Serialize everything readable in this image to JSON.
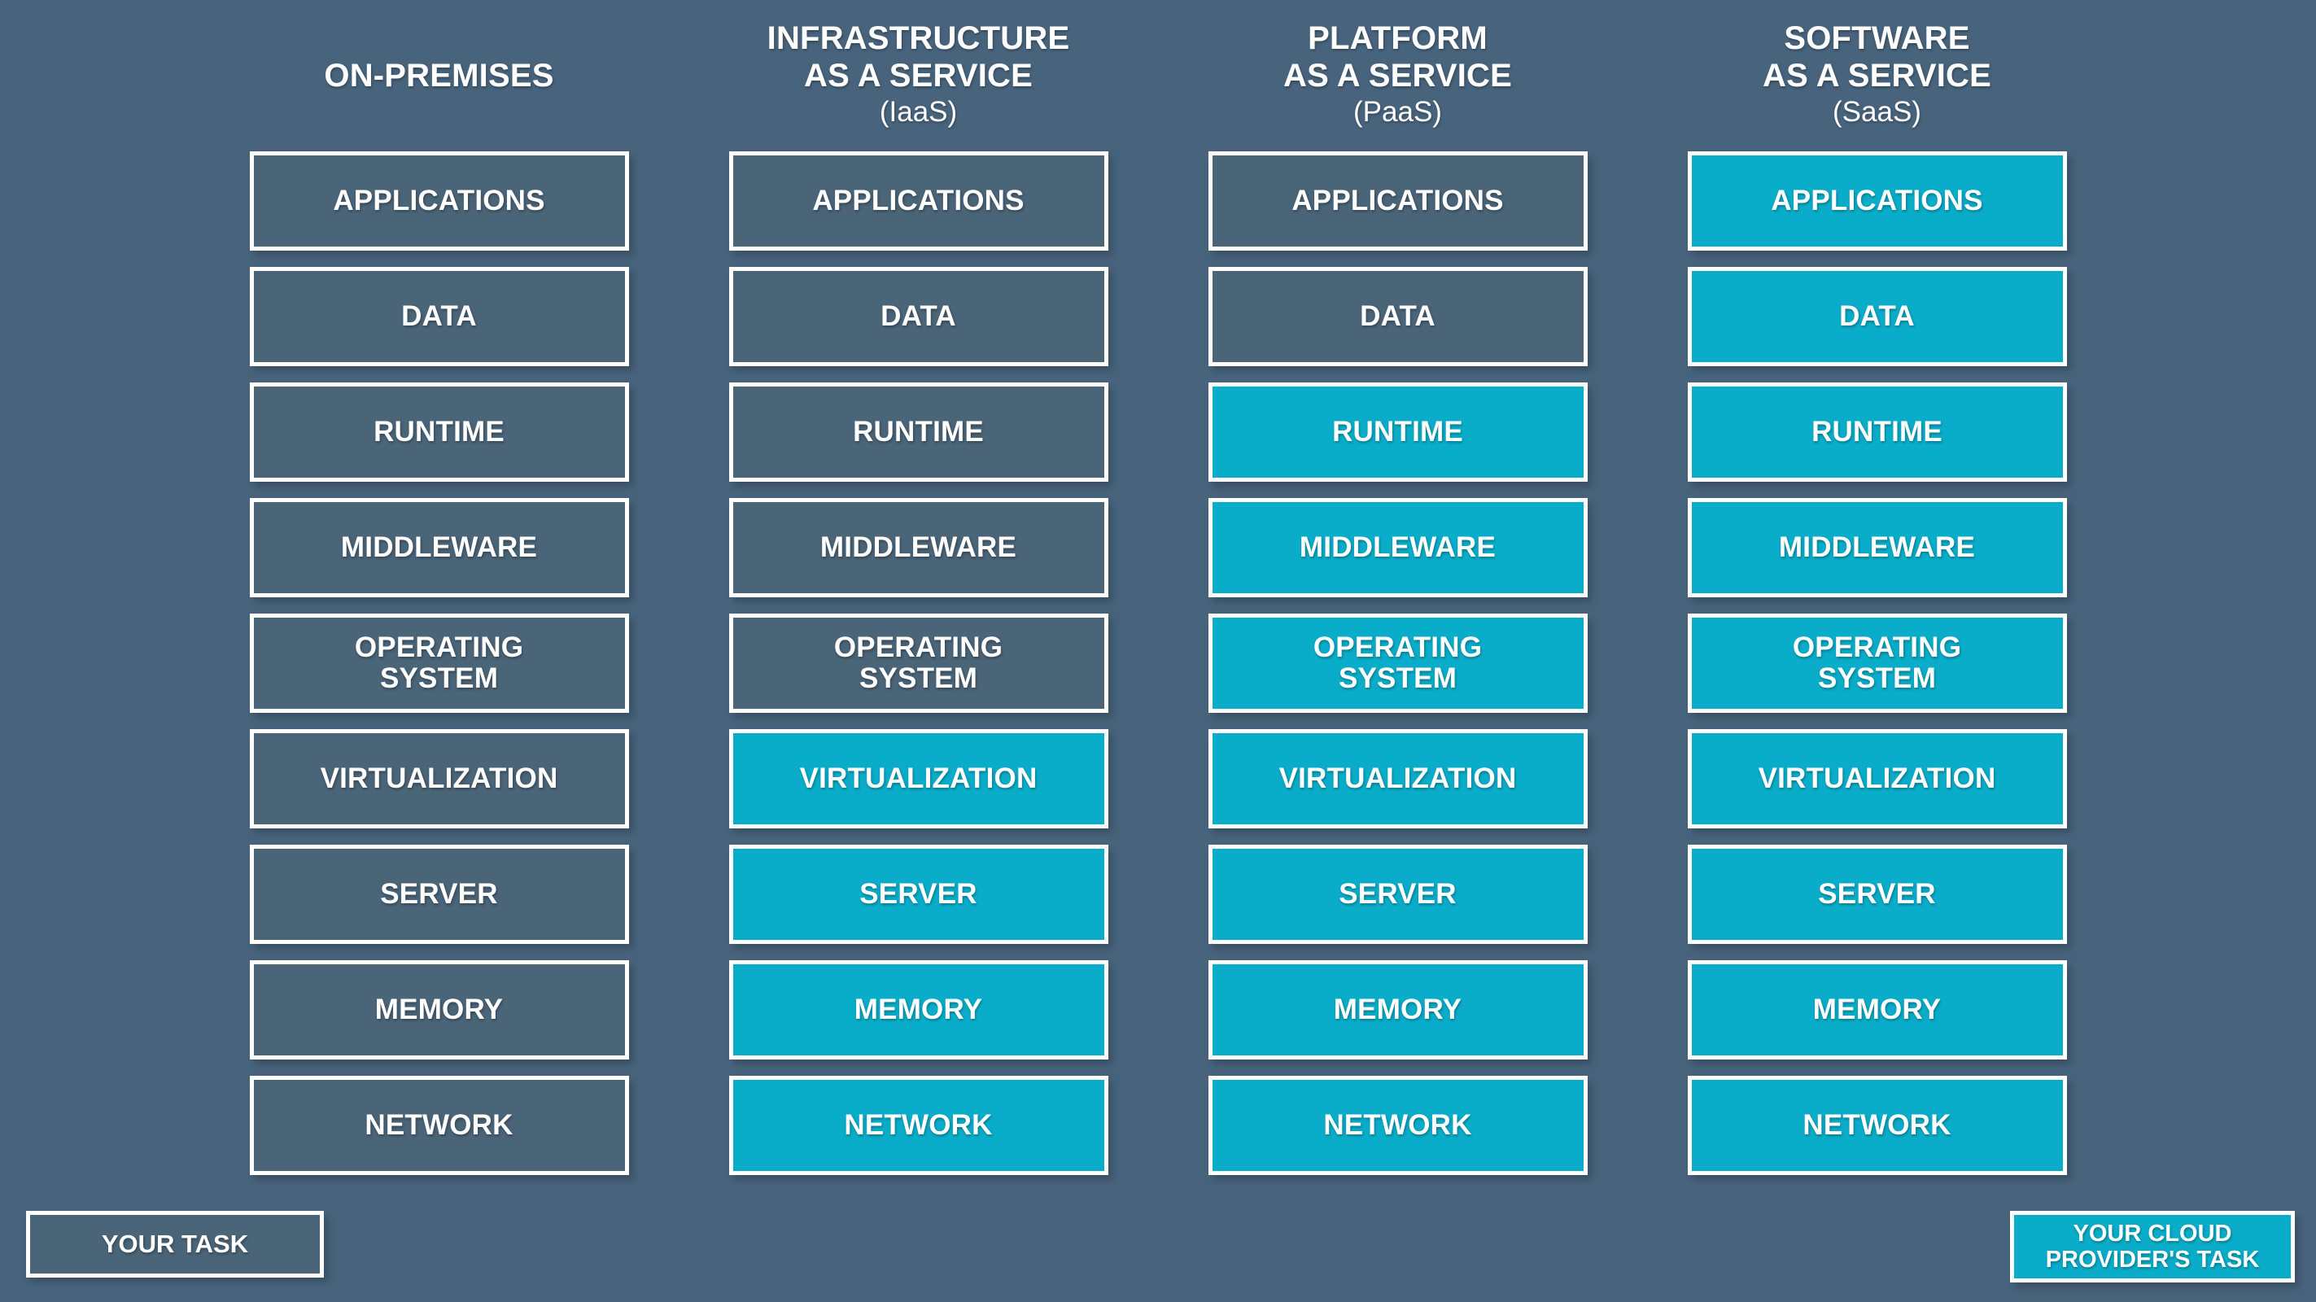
{
  "palette": {
    "background": "#48647d",
    "box_dark": "#4a6478",
    "provider_cyan": "#0aadc9",
    "border": "#ffffff",
    "text": "#ffffff"
  },
  "columns": [
    {
      "key": "on-premises",
      "title_lines": [
        "ON-PREMISES"
      ],
      "abbr": "",
      "layers": [
        {
          "label": "APPLICATIONS",
          "owner": "you"
        },
        {
          "label": "DATA",
          "owner": "you"
        },
        {
          "label": "RUNTIME",
          "owner": "you"
        },
        {
          "label": "MIDDLEWARE",
          "owner": "you"
        },
        {
          "label": "OPERATING\nSYSTEM",
          "owner": "you"
        },
        {
          "label": "VIRTUALIZATION",
          "owner": "you"
        },
        {
          "label": "SERVER",
          "owner": "you"
        },
        {
          "label": "MEMORY",
          "owner": "you"
        },
        {
          "label": "NETWORK",
          "owner": "you"
        }
      ]
    },
    {
      "key": "iaas",
      "title_lines": [
        "INFRASTRUCTURE",
        "AS A SERVICE"
      ],
      "abbr": "(IaaS)",
      "layers": [
        {
          "label": "APPLICATIONS",
          "owner": "you"
        },
        {
          "label": "DATA",
          "owner": "you"
        },
        {
          "label": "RUNTIME",
          "owner": "you"
        },
        {
          "label": "MIDDLEWARE",
          "owner": "you"
        },
        {
          "label": "OPERATING\nSYSTEM",
          "owner": "you"
        },
        {
          "label": "VIRTUALIZATION",
          "owner": "provider"
        },
        {
          "label": "SERVER",
          "owner": "provider"
        },
        {
          "label": "MEMORY",
          "owner": "provider"
        },
        {
          "label": "NETWORK",
          "owner": "provider"
        }
      ]
    },
    {
      "key": "paas",
      "title_lines": [
        "PLATFORM",
        "AS A SERVICE"
      ],
      "abbr": "(PaaS)",
      "layers": [
        {
          "label": "APPLICATIONS",
          "owner": "you"
        },
        {
          "label": "DATA",
          "owner": "you"
        },
        {
          "label": "RUNTIME",
          "owner": "provider"
        },
        {
          "label": "MIDDLEWARE",
          "owner": "provider"
        },
        {
          "label": "OPERATING\nSYSTEM",
          "owner": "provider"
        },
        {
          "label": "VIRTUALIZATION",
          "owner": "provider"
        },
        {
          "label": "SERVER",
          "owner": "provider"
        },
        {
          "label": "MEMORY",
          "owner": "provider"
        },
        {
          "label": "NETWORK",
          "owner": "provider"
        }
      ]
    },
    {
      "key": "saas",
      "title_lines": [
        "SOFTWARE",
        "AS A SERVICE"
      ],
      "abbr": "(SaaS)",
      "layers": [
        {
          "label": "APPLICATIONS",
          "owner": "provider"
        },
        {
          "label": "DATA",
          "owner": "provider"
        },
        {
          "label": "RUNTIME",
          "owner": "provider"
        },
        {
          "label": "MIDDLEWARE",
          "owner": "provider"
        },
        {
          "label": "OPERATING\nSYSTEM",
          "owner": "provider"
        },
        {
          "label": "VIRTUALIZATION",
          "owner": "provider"
        },
        {
          "label": "SERVER",
          "owner": "provider"
        },
        {
          "label": "MEMORY",
          "owner": "provider"
        },
        {
          "label": "NETWORK",
          "owner": "provider"
        }
      ]
    }
  ],
  "legend": {
    "your_task": "YOUR TASK",
    "provider_task": "YOUR CLOUD\nPROVIDER'S TASK"
  }
}
